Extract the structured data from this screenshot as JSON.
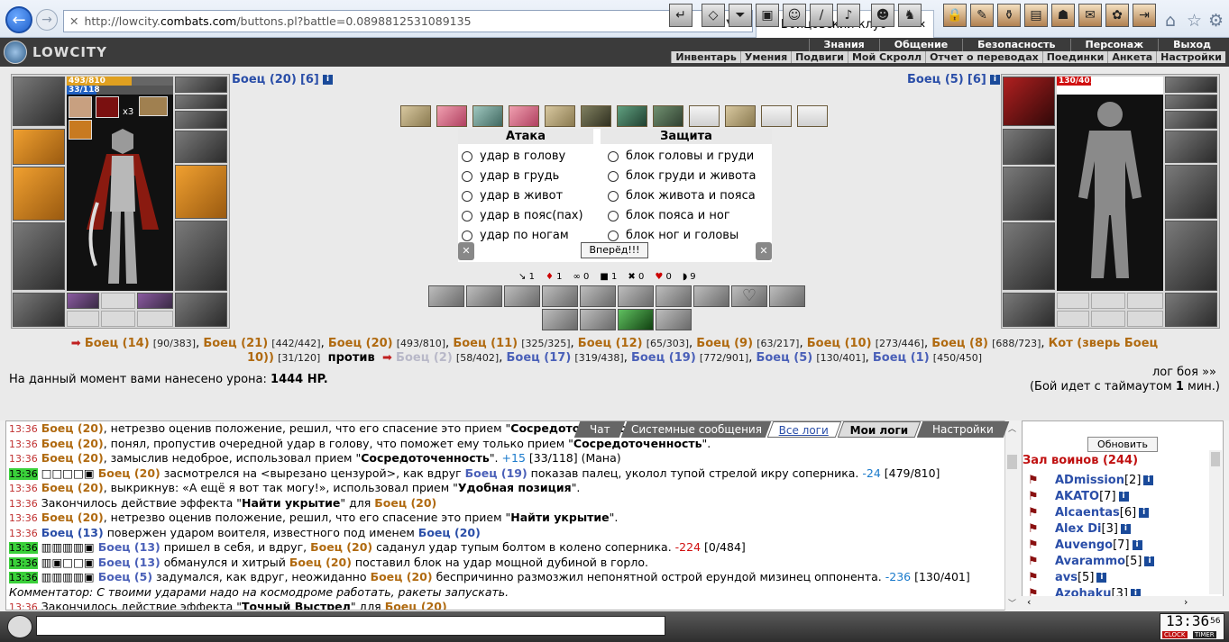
{
  "browser": {
    "url_prefix": "http://lowcity.",
    "url_domain": "combats.com",
    "url_rest": "/buttons.pl?battle=0.0898812531089135",
    "search_icon": "⌕ ▾",
    "refresh_icon": "↻",
    "tab_title": "Бойцовский клуб",
    "tab_close": "✕"
  },
  "header": {
    "logo": "LOWCITY",
    "menu_top": [
      "Знания",
      "Общение",
      "Безопасность",
      "Персонаж",
      "Выход"
    ],
    "menu_sub": [
      "Инвентарь",
      "Умения",
      "Подвиги",
      "Мой Скролл",
      "Отчет о переводах",
      "Поединки",
      "Анкета",
      "Настройки"
    ]
  },
  "left_fighter": {
    "name": "Боец (20)",
    "level": "[6]",
    "hp": "493/810",
    "mana": "33/118",
    "hp_frac": 0.61,
    "mana_frac": 0.28,
    "badge": "x3"
  },
  "right_fighter": {
    "name": "Боец (5)",
    "level": "[6]",
    "hp": "130/401",
    "hp_frac": 0.32
  },
  "combat": {
    "attack_header": "Атака",
    "defense_header": "Защита",
    "attacks": [
      "удар в голову",
      "удар в грудь",
      "удар в живот",
      "удар в пояс(пах)",
      "удар по ногам"
    ],
    "defenses": [
      "блок головы и груди",
      "блок груди и живота",
      "блок живота и пояса",
      "блок пояса и ног",
      "блок ног и головы"
    ],
    "forward_button": "Вперёд!!!",
    "counters": [
      "1",
      "1",
      "0",
      "1",
      "0",
      "0",
      "9"
    ]
  },
  "teams": {
    "team1": [
      {
        "n": "Боец (14)",
        "hp": "[90/383]"
      },
      {
        "n": "Боец (21)",
        "hp": "[442/442]"
      },
      {
        "n": "Боец (20)",
        "hp": "[493/810]"
      },
      {
        "n": "Боец (11)",
        "hp": "[325/325]"
      },
      {
        "n": "Боец (12)",
        "hp": "[65/303]"
      },
      {
        "n": "Боец (9)",
        "hp": "[63/217]"
      },
      {
        "n": "Боец (10)",
        "hp": "[273/446]"
      },
      {
        "n": "Боец (8)",
        "hp": "[688/723]"
      },
      {
        "n": "Кот (зверь Боец",
        "hp": ""
      }
    ],
    "team1_tail": "10))",
    "team1_tail_hp": "[31/120]",
    "vs": "против",
    "team2": [
      {
        "n": "Боец (2)",
        "hp": "[58/402]"
      },
      {
        "n": "Боец (17)",
        "hp": "[319/438]"
      },
      {
        "n": "Боец (19)",
        "hp": "[772/901]"
      },
      {
        "n": "Боец (5)",
        "hp": "[130/401]"
      },
      {
        "n": "Боец (1)",
        "hp": "[450/450]"
      }
    ],
    "damage_label": "На данный момент вами нанесено урона:",
    "damage_value": "1444 HP.",
    "log_link": "лог боя »»",
    "timeout_prefix": "(Бой идет с таймаутом",
    "timeout_value": "1",
    "timeout_suffix": "мин.)"
  },
  "chat_tabs": [
    "Чат",
    "Системные сообщения",
    "Все логи",
    "Мои логи",
    "Настройки"
  ],
  "chat_log": [
    {
      "t": "13:36",
      "g": false,
      "html": "<span class='t1'>Боец (20)</span>, нетрезво оценив положение, решил, что его спасение это прием \"<b>Сосредоточенность</b>\"."
    },
    {
      "t": "13:36",
      "g": false,
      "html": "<span class='t1'>Боец (20)</span>, понял, пропустив очередной удар в голову, что поможет ему только прием \"<b>Сосредоточенность</b>\"."
    },
    {
      "t": "13:36",
      "g": false,
      "html": "<span class='t1'>Боец (20)</span>, замыслив недоброе, использовал прием \"<b>Сосредоточенность</b>\". <span class='dmg b'>+15</span> [33/118] (Мана)"
    },
    {
      "t": "13:36",
      "g": true,
      "html": "□□□□▣ <span class='t1'>Боец (20)</span> засмотрелся на &lt;вырезано цензурой&gt;, как вдруг <span class='t2'>Боец (19)</span> показав палец, уколол тупой стрелой икру соперника. <span class='dmg b'>-24</span> [479/810]"
    },
    {
      "t": "13:36",
      "g": false,
      "html": "<span class='t1'>Боец (20)</span>, выкрикнув: «А ещё я вот так могу!», использовал прием \"<b>Удобная позиция</b>\"."
    },
    {
      "t": "13:36",
      "g": false,
      "html": "Закончилось действие эффекта \"<b>Найти укрытие</b>\" для <span class='t1'>Боец (20)</span>"
    },
    {
      "t": "13:36",
      "g": false,
      "html": "<span class='t1'>Боец (20)</span>, нетрезво оценив положение, решил, что его спасение это прием \"<b>Найти укрытие</b>\"."
    },
    {
      "t": "13:36",
      "g": false,
      "html": "<span class='lnk'>Боец (13)</span> повержен ударом воителя, известного под именем <span class='lnk'>Боец (20)</span>"
    },
    {
      "t": "13:36",
      "g": true,
      "html": "▥▥▥▥▣ <span class='t2'>Боец (13)</span> пришел в себя, и вдруг, <span class='t1'>Боец (20)</span> саданул удар тупым болтом в колено соперника. <span class='dmg'>-224</span> [0/484]"
    },
    {
      "t": "13:36",
      "g": true,
      "html": "▥▣□□▣ <span class='t2'>Боец (13)</span> обманулся и хитрый <span class='t1'>Боец (20)</span> поставил блок на удар мощной дубиной в горло."
    },
    {
      "t": "13:36",
      "g": true,
      "html": "▥▥▥▥▣ <span class='t2'>Боец (5)</span> задумался, как вдруг, неожиданно <span class='t1'>Боец (20)</span> беспричинно размозжил непонятной острой ерундой мизинец оппонента. <span class='dmg b'>-236</span> [130/401]"
    },
    {
      "t": "",
      "g": false,
      "html": "<i>Комментатор: С твоими ударами надо на космодроме работать, ракеты запускать.</i>"
    },
    {
      "t": "13:36",
      "g": false,
      "html": "Закончилось действие эффекта \"<b>Точный Выстрел</b>\" для <span class='t1'>Боец (20)</span>"
    }
  ],
  "warriors": {
    "refresh_button": "Обновить",
    "title": "Зал воинов (244)",
    "items": [
      {
        "name": "ADmission",
        "lvl": "[2]"
      },
      {
        "name": "AKATO",
        "lvl": "[7]"
      },
      {
        "name": "Alcaentas",
        "lvl": "[6]"
      },
      {
        "name": "Alex Di",
        "lvl": "[3]"
      },
      {
        "name": "Auvengo",
        "lvl": "[7]"
      },
      {
        "name": "Avarammo",
        "lvl": "[5]"
      },
      {
        "name": "avs",
        "lvl": "[5]"
      },
      {
        "name": "Azohaku",
        "lvl": "[3]"
      }
    ]
  },
  "bottom": {
    "time": "13:36",
    "seconds": "56",
    "clock_label": "CLOCK",
    "timer_label": "TIMER"
  }
}
